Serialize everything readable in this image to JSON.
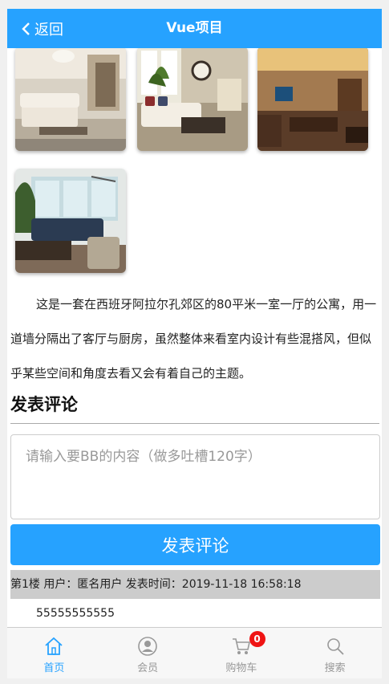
{
  "header": {
    "back_label": "返回",
    "title": "Vue项目"
  },
  "gallery": {
    "images": [
      {
        "alt": "living-room-1"
      },
      {
        "alt": "living-room-2"
      },
      {
        "alt": "living-room-3"
      },
      {
        "alt": "living-room-4"
      }
    ]
  },
  "article": {
    "description": "这是一套在西班牙阿拉尔孔郊区的80平米一室一厅的公寓，用一道墙分隔出了客厅与厨房，虽然整体来看室内设计有些混搭风，但似乎某些空间和角度去看又会有着自己的主题。"
  },
  "comment_form": {
    "section_title": "发表评论",
    "placeholder": "请输入要BB的内容（做多吐槽120字）",
    "submit_label": "发表评论"
  },
  "comments": [
    {
      "meta": "第1楼  用户：匿名用户  发表时间：2019-11-18 16:58:18",
      "content": "55555555555"
    }
  ],
  "tabbar": {
    "items": [
      {
        "label": "首页",
        "icon": "home-icon",
        "active": true
      },
      {
        "label": "会员",
        "icon": "user-icon",
        "active": false
      },
      {
        "label": "购物车",
        "icon": "cart-icon",
        "active": false
      },
      {
        "label": "搜索",
        "icon": "search-icon",
        "active": false
      }
    ],
    "cart_badge": "0"
  },
  "colors": {
    "primary": "#26a2ff",
    "badge": "#ef1414",
    "meta_bg": "#cccccc"
  }
}
